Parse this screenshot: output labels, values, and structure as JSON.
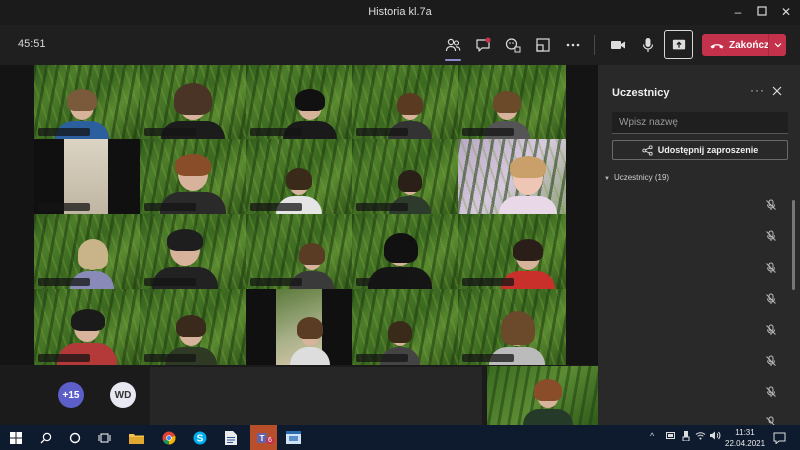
{
  "window": {
    "title": "Historia kl.7a"
  },
  "toolbar": {
    "timer": "45:51",
    "end_call_label": "Zakończ",
    "icons": [
      "people-icon",
      "chat-icon",
      "reactions-icon",
      "rooms-icon",
      "more-icon",
      "camera-icon",
      "microphone-icon",
      "share-screen-icon",
      "phone-hangup-icon"
    ]
  },
  "stage": {
    "overflow_count": "+15",
    "extra_avatar_initials": "WD"
  },
  "panel": {
    "title": "Uczestnicy",
    "search_placeholder": "Wpisz nazwę",
    "invite_label": "Udostępnij zaproszenie",
    "section_label": "Uczestnicy (19)"
  },
  "taskbar": {
    "time": "11:31",
    "date": "22.04.2021",
    "teams_badge": "6"
  },
  "colors": {
    "accent": "#6264a7",
    "end_call": "#c4314b",
    "panel_bg": "#292929"
  }
}
